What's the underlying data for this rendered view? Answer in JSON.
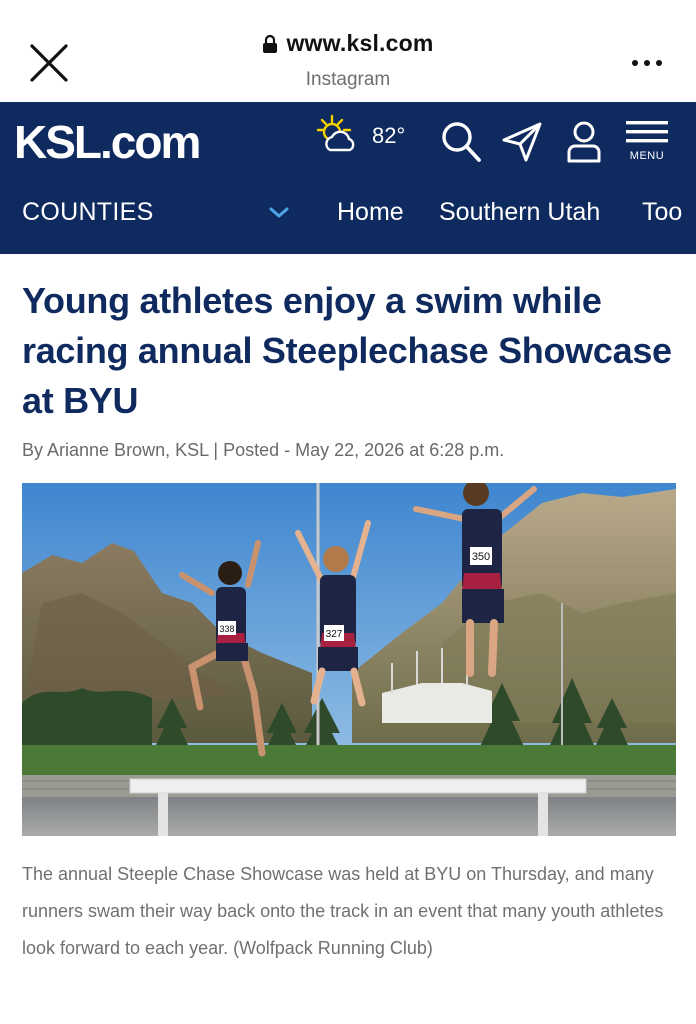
{
  "browser": {
    "url": "www.ksl.com",
    "subtitle": "Instagram"
  },
  "header": {
    "logo": "KSL.com",
    "temperature": "82°",
    "menu_label": "MENU",
    "nav": {
      "section": "COUNTIES",
      "items": [
        "Home",
        "Southern Utah",
        "Too"
      ]
    }
  },
  "article": {
    "headline": "Young athletes enjoy a swim while racing annual Steeplechase Showcase at BYU",
    "byline": "By Arianne Brown, KSL | Posted - May 22, 2026 at 6:28 p.m.",
    "bibs": [
      "338",
      "327",
      "350"
    ],
    "caption": "The annual Steeple Chase Showcase was held at BYU on Thursday, and many runners swam their way back onto the track in an event that many youth athletes look forward to each year. (Wolfpack Running Club)"
  },
  "colors": {
    "brand_navy": "#0f2a5f",
    "headline": "#0f2a5f",
    "weather_sun": "#f5d000",
    "chevron": "#4ea3e6"
  }
}
